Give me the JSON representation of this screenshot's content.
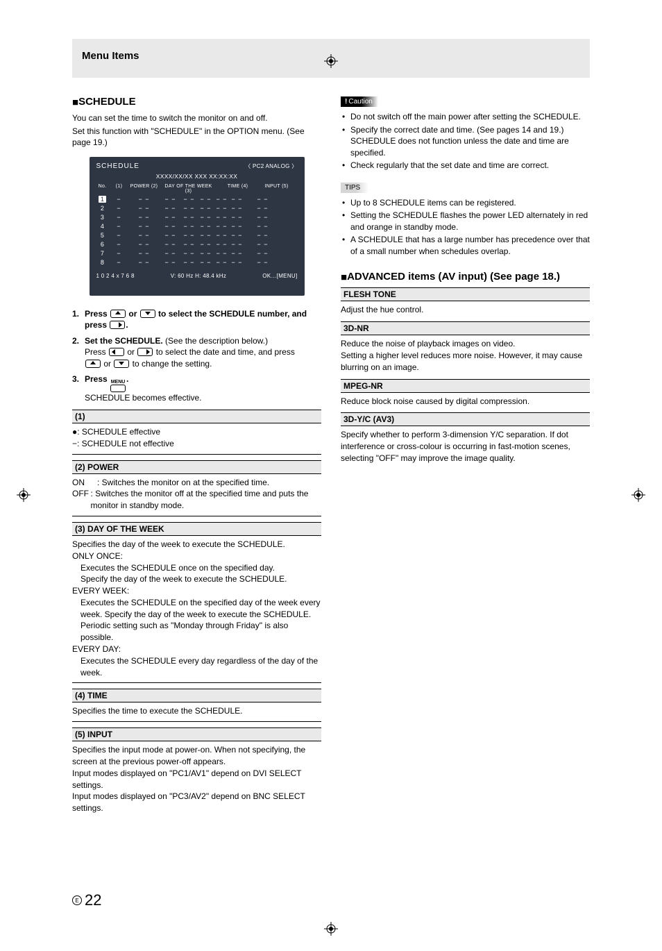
{
  "header": {
    "title": "Menu Items"
  },
  "schedule": {
    "title": "SCHEDULE",
    "intro1": "You can set the time to switch the monitor on and off.",
    "intro2": "Set this function with \"SCHEDULE\" in the OPTION menu. (See page 19.)",
    "osd": {
      "title": "SCHEDULE",
      "mode": "〈 PC2 ANALOG 〉",
      "date": "XXXX/XX/XX XXX XX:XX:XX",
      "head_no": "No.",
      "head_1": "(1)",
      "head_power": "POWER (2)",
      "head_dow": "DAY OF THE WEEK (3)",
      "head_time": "TIME (4)",
      "head_input": "INPUT (5)",
      "rows": [
        "1",
        "2",
        "3",
        "4",
        "5",
        "6",
        "7",
        "8"
      ],
      "res": "1 0 2 4 x 7 6 8",
      "vh": "V: 60 Hz    H: 48.4 kHz",
      "ok": "OK…[MENU]"
    },
    "steps": {
      "s1a": "Press ",
      "s1b": " or ",
      "s1c": " to select the SCHEDULE number, and press ",
      "s1d": ".",
      "s2a": "Set the SCHEDULE.",
      "s2b": " (See the description below.)",
      "s2c": "Press ",
      "s2d": " or ",
      "s2e": " to select the date and time, and press ",
      "s2f": " or ",
      "s2g": " to change the setting.",
      "s3a": "Press ",
      "s3b": ".",
      "s3c": "SCHEDULE becomes effective.",
      "menu_label": "MENU"
    },
    "items": {
      "h1": "(1)",
      "b1a": "●: SCHEDULE effective",
      "b1b": "−: SCHEDULE not effective",
      "h2": "(2) POWER",
      "b2a_on": "ON",
      "b2a": ": Switches the monitor on at the specified time.",
      "b2b_off": "OFF",
      "b2b": ": Switches the monitor off at the specified time and puts the monitor in standby mode.",
      "h3": "(3) DAY OF THE WEEK",
      "b3a": "Specifies the day of the week to execute the SCHEDULE.",
      "b3b": "ONLY ONCE:",
      "b3c": "Executes the SCHEDULE once on the specified day.",
      "b3d": "Specify the day of the week to execute the SCHEDULE.",
      "b3e": "EVERY WEEK:",
      "b3f": "Executes the SCHEDULE on the specified day of the week every week. Specify the day of the week to execute the SCHEDULE.",
      "b3g": "Periodic setting such as \"Monday through Friday\" is also possible.",
      "b3h": "EVERY DAY:",
      "b3i": "Executes the SCHEDULE every day regardless of the day of the week.",
      "h4": "(4) TIME",
      "b4": "Specifies the time to execute the SCHEDULE.",
      "h5": "(5) INPUT",
      "b5a": "Specifies the input mode at power-on. When not specifying, the screen at the previous power-off appears.",
      "b5b": "Input modes displayed on \"PC1/AV1\" depend on DVI SELECT settings.",
      "b5c": "Input modes displayed on \"PC3/AV2\" depend on BNC SELECT settings."
    }
  },
  "caution": {
    "label": "Caution",
    "c1": "Do not switch off the main power after setting the SCHEDULE.",
    "c2": "Specify the correct date and time. (See pages 14 and 19.) SCHEDULE does not function unless the date and time are specified.",
    "c3": "Check regularly that the set date and time are correct."
  },
  "tips": {
    "label": "TIPS",
    "t1": "Up to 8 SCHEDULE items can be registered.",
    "t2": "Setting the SCHEDULE flashes the power LED alternately in red and orange in standby mode.",
    "t3": "A SCHEDULE that has a large number has precedence over that of a small number when schedules overlap."
  },
  "advanced": {
    "title": "ADVANCED items (AV input) (See page 18.)",
    "flesh_h": "FLESH TONE",
    "flesh_b": "Adjust the hue control.",
    "nr3d_h": "3D-NR",
    "nr3d_b1": "Reduce the noise of playback images on video.",
    "nr3d_b2": "Setting a higher level reduces more noise. However, it may cause blurring on an image.",
    "mpeg_h": "MPEG-NR",
    "mpeg_b": "Reduce block noise caused by digital compression.",
    "yc_h": "3D-Y/C (AV3)",
    "yc_b": "Specify whether to perform 3-dimension Y/C separation. If dot interference or cross-colour is occurring in fast-motion scenes, selecting \"OFF\" may improve the image quality."
  },
  "page_number": {
    "e": "E",
    "num": "22"
  }
}
